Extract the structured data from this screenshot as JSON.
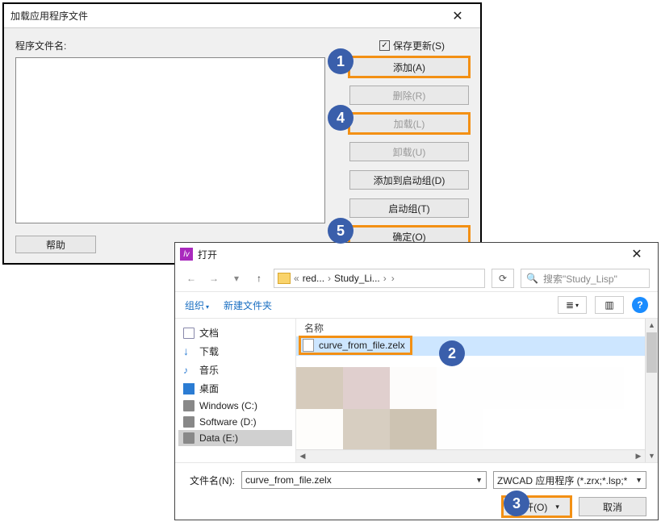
{
  "markers": {
    "m1": "1",
    "m2": "2",
    "m3": "3",
    "m4": "4",
    "m5": "5"
  },
  "load_dialog": {
    "title": "加载应用程序文件",
    "close_glyph": "✕",
    "file_list_label": "程序文件名:",
    "save_update_label": "保存更新(S)",
    "save_update_checked": "✓",
    "buttons": {
      "add": "添加(A)",
      "delete": "删除(R)",
      "load": "加载(L)",
      "unload": "卸载(U)",
      "add_to_startup": "添加到启动组(D)",
      "startup_group": "启动组(T)",
      "ok": "确定(O)"
    },
    "help": "帮助"
  },
  "open_dialog": {
    "title": "打开",
    "close_glyph": "✕",
    "nav_back": "←",
    "nav_fwd": "→",
    "nav_up": "↑",
    "nav_dd": "▾",
    "breadcrumb": {
      "pre": "«",
      "p1": "red...",
      "p2": "Study_Li...",
      "sep": "›",
      "tail": "›"
    },
    "refresh_glyph": "⟳",
    "search_icon": "🔍",
    "search_placeholder": "搜索\"Study_Lisp\"",
    "toolbar": {
      "organize": "组织",
      "new_folder": "新建文件夹",
      "view_icon": "≣",
      "view_dd": "▾",
      "panel_icon": "▥",
      "help": "?"
    },
    "tree": {
      "docs": "文档",
      "downloads": "下载",
      "music": "音乐",
      "desktop": "桌面",
      "c_drive": "Windows (C:)",
      "d_drive": "Software (D:)",
      "e_drive": "Data (E:)"
    },
    "column_header": "名称",
    "file_name": "curve_from_file.zelx",
    "filename_label": "文件名(N):",
    "filename_value": "curve_from_file.zelx",
    "filter_value": "ZWCAD 应用程序 (*.zrx;*.lsp;*",
    "open_btn": "打开(O)",
    "open_dd": "▾",
    "cancel_btn": "取消"
  }
}
